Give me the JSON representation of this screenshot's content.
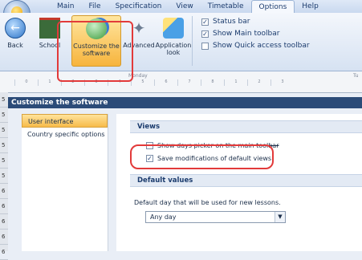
{
  "ribbon": {
    "tabs": [
      "Main",
      "File",
      "Specification",
      "View",
      "Timetable",
      "Options",
      "Help"
    ],
    "active_tab": "Options",
    "buttons": [
      {
        "label": "Back",
        "icon": "back-arrow-icon"
      },
      {
        "label": "School",
        "icon": "school-board-icon"
      },
      {
        "label": "Customize the software",
        "icon": "customize-icon"
      },
      {
        "label": "Advanced",
        "icon": "tools-icon"
      },
      {
        "label": "Application look",
        "icon": "paint-icon"
      }
    ],
    "checkboxes": [
      {
        "label": "Status bar",
        "checked": true
      },
      {
        "label": "Show Main toolbar",
        "checked": true
      },
      {
        "label": "Show Quick access toolbar",
        "checked": false
      }
    ]
  },
  "grid": {
    "day": "Monday",
    "day2": "Tu",
    "hours": [
      "0",
      "1",
      "2",
      "3",
      "4",
      "5",
      "6",
      "7",
      "8",
      "1",
      "2",
      "3"
    ],
    "row_numbers": [
      "5",
      "5",
      "5",
      "5",
      "5",
      "5",
      "6",
      "6",
      "6",
      "6",
      "6"
    ]
  },
  "panel": {
    "title": "Customize the software",
    "nav": [
      "User interface",
      "Country specific options"
    ],
    "active_nav": "User interface"
  },
  "views": {
    "heading": "Views",
    "options": [
      {
        "label": "Show days picker on the main toolbar",
        "checked": false
      },
      {
        "label": "Save modifications of default views",
        "checked": true
      }
    ]
  },
  "defaults": {
    "heading": "Default values",
    "description": "Default day that will be used for new lessons.",
    "day_value": "Any day"
  },
  "colors": {
    "title_bar": "#2b4b78",
    "highlight": "#f7bb4a",
    "annotation": "#e23a3a"
  }
}
